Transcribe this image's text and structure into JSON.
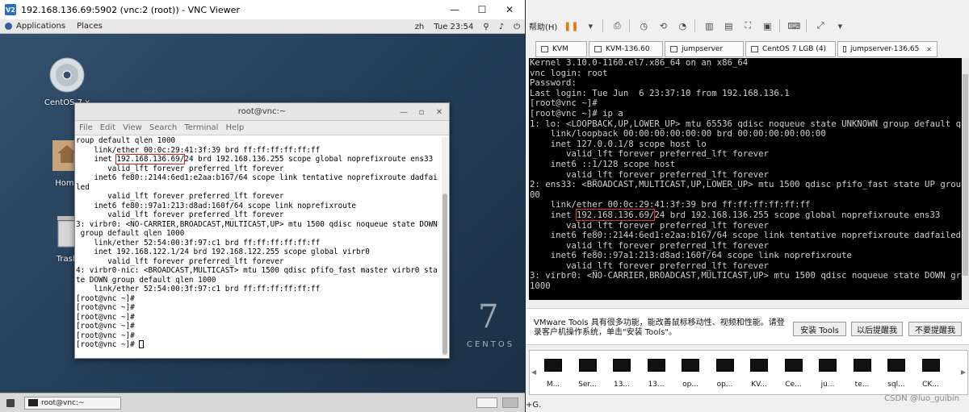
{
  "vnc": {
    "title": "192.168.136.69:5902 (vnc:2 (root)) - VNC Viewer",
    "icon_label": "V2",
    "minimize": "—",
    "maximize": "☐",
    "close": "✕"
  },
  "gnome_bar": {
    "applications": "Applications",
    "places": "Places",
    "lang": "zh",
    "clock": "Tue 23:54"
  },
  "desktop": {
    "icons": [
      "CentOS 7 x",
      "Home",
      "Trash"
    ],
    "brand_number": "7",
    "brand_text": "CENTOS"
  },
  "terminal": {
    "title": "root@vnc:~",
    "menu": [
      "File",
      "Edit",
      "View",
      "Search",
      "Terminal",
      "Help"
    ],
    "lines": [
      "roup default qlen 1000",
      "    link/ether 00:0c:29:41:3f:39 brd ff:ff:ff:ff:ff:ff",
      "    inet ",
      "       valid_lft forever preferred_lft forever",
      "    inet6 fe80::2144:6ed1:e2aa:b167/64 scope link tentative noprefixroute dadfai",
      "led",
      "       valid_lft forever preferred_lft forever",
      "    inet6 fe80::97a1:213:d8ad:160f/64 scope link noprefixroute",
      "       valid_lft forever preferred_lft forever",
      "3: virbr0: <NO-CARRIER,BROADCAST,MULTICAST,UP> mtu 1500 qdisc noqueue state DOWN",
      " group default qlen 1000",
      "    link/ether 52:54:00:3f:97:c1 brd ff:ff:ff:ff:ff:ff",
      "    inet 192.168.122.1/24 brd 192.168.122.255 scope global virbr0",
      "       valid_lft forever preferred_lft forever",
      "4: virbr0-nic: <BROADCAST,MULTICAST> mtu 1500 qdisc pfifo_fast master virbr0 sta",
      "te DOWN group default qlen 1000",
      "    link/ether 52:54:00:3f:97:c1 brd ff:ff:ff:ff:ff:ff",
      "[root@vnc ~]#",
      "[root@vnc ~]#",
      "[root@vnc ~]#",
      "[root@vnc ~]#",
      "[root@vnc ~]#",
      "[root@vnc ~]# "
    ],
    "ip_highlight": "192.168.136.69/",
    "ip_rest": "24 brd 192.168.136.255 scope global noprefixroute ens33"
  },
  "vnc_taskbar": {
    "item": "root@vnc:~"
  },
  "vmware": {
    "help_menu": "帮助(H)",
    "tabs": [
      "KVM",
      "KVM-136.60",
      "jumpserver",
      "CentOS 7 LGB (4)",
      "jumpserver-136.65"
    ],
    "console_lines": [
      "Kernel 3.10.0-1160.el7.x86_64 on an x86_64",
      "",
      "vnc login: root",
      "Password:",
      "Last login: Tue Jun  6 23:37:10 from 192.168.136.1",
      "[root@vnc ~]#",
      "[root@vnc ~]# ip a",
      "1: lo: <LOOPBACK,UP,LOWER_UP> mtu 65536 qdisc noqueue state UNKNOWN group default ql",
      "    link/loopback 00:00:00:00:00:00 brd 00:00:00:00:00:00",
      "    inet 127.0.0.1/8 scope host lo",
      "       valid_lft forever preferred_lft forever",
      "    inet6 ::1/128 scope host",
      "       valid_lft forever preferred_lft forever",
      "2: ens33: <BROADCAST,MULTICAST,UP,LOWER_UP> mtu 1500 qdisc pfifo_fast state UP group",
      "00",
      "    link/ether 00:0c:29:41:3f:39 brd ff:ff:ff:ff:ff:ff",
      "    inet ",
      "       valid_lft forever preferred_lft forever",
      "    inet6 fe80::2144:6ed1:e2aa:b167/64 scope link tentative noprefixroute dadfailed",
      "       valid_lft forever preferred_lft forever",
      "    inet6 fe80::97a1:213:d8ad:160f/64 scope link noprefixroute",
      "       valid_lft forever preferred_lft forever",
      "3: virbr0: <NO-CARRIER,BROADCAST,MULTICAST,UP> mtu 1500 qdisc noqueue state DOWN gro",
      "1000"
    ],
    "ip_highlight": "192.168.136.69/",
    "ip_rest": "24 brd 192.168.136.255 scope global noprefixroute ens33",
    "notice": "VMware Tools 具有很多功能，能改善鼠标移动性、视频和性能。请登录客户机操作系统，单击\"安装 Tools\"。",
    "buttons": [
      "安装 Tools",
      "以后提醒我",
      "不要提醒我"
    ],
    "thumbs": [
      "M...",
      "Ser...",
      "13...",
      "13...",
      "op...",
      "op...",
      "KV...",
      "Ce...",
      "ju...",
      "te...",
      "sql...",
      "CK..."
    ],
    "status_left": "+G.",
    "watermark": "CSDN @luo_guibin"
  },
  "colors": {
    "highlight": "#d32020",
    "desktop": "#2b4662"
  }
}
